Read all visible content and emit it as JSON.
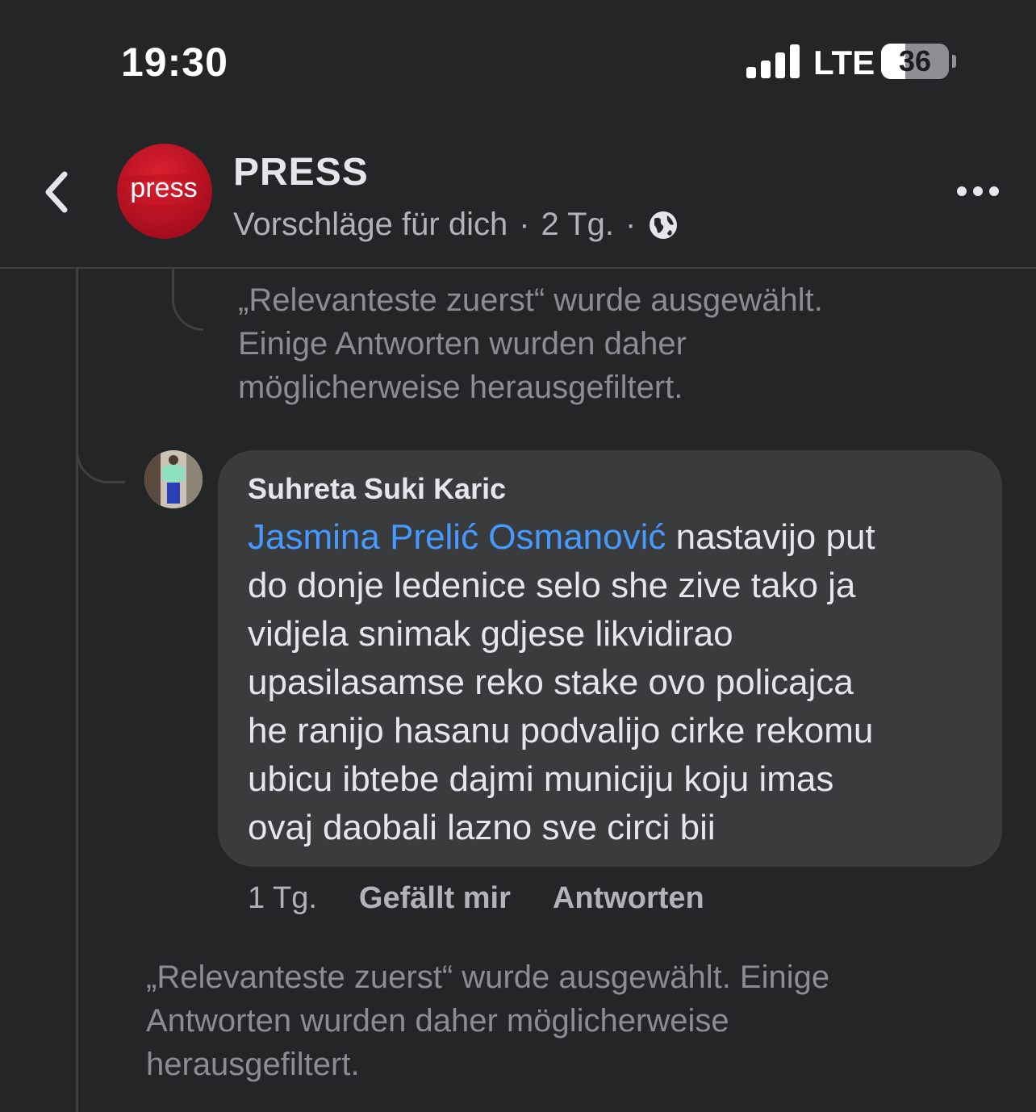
{
  "status_bar": {
    "time": "19:30",
    "network": "LTE",
    "battery_percent": "36",
    "signal_bars": 4
  },
  "header": {
    "avatar_text": "press",
    "page_name": "PRESS",
    "subtitle": "Vorschläge für dich",
    "separator": "·",
    "age": "2 Tg.",
    "icons": [
      "back-chevron-icon",
      "globe-icon",
      "more-options-icon"
    ]
  },
  "filter_notice_top": {
    "lines": [
      "„Relevanteste zuerst“ wurde ausgewählt.",
      "Einige Antworten wurden daher",
      "möglicherweise herausgefiltert."
    ]
  },
  "comment": {
    "author": "Suhreta Suki Karic",
    "mention": "Jasmina Prelić Osmanović",
    "lines": [
      " nastavijo put",
      "do donje ledenice selo she zive tako ja",
      "vidjela snimak gdjese likvidirao",
      "upasilasamse reko stake ovo policajca",
      "he ranijo hasanu podvalijo cirke rekomu",
      "ubicu ibtebe dajmi municiju koju imas",
      "ovaj daobali lazno sve circi bii"
    ],
    "time": "1 Tg.",
    "like_label": "Gefällt mir",
    "reply_label": "Antworten"
  },
  "filter_notice_bottom": {
    "lines": [
      "„Relevanteste zuerst“ wurde ausgewählt. Einige",
      "Antworten wurden daher möglicherweise",
      "herausgefiltert."
    ]
  },
  "colors": {
    "background": "#242526",
    "bubble": "#3a3b3c",
    "mention": "#4599ff",
    "secondary_text": "#b0b3b8",
    "brand_red": "#c8102e"
  }
}
